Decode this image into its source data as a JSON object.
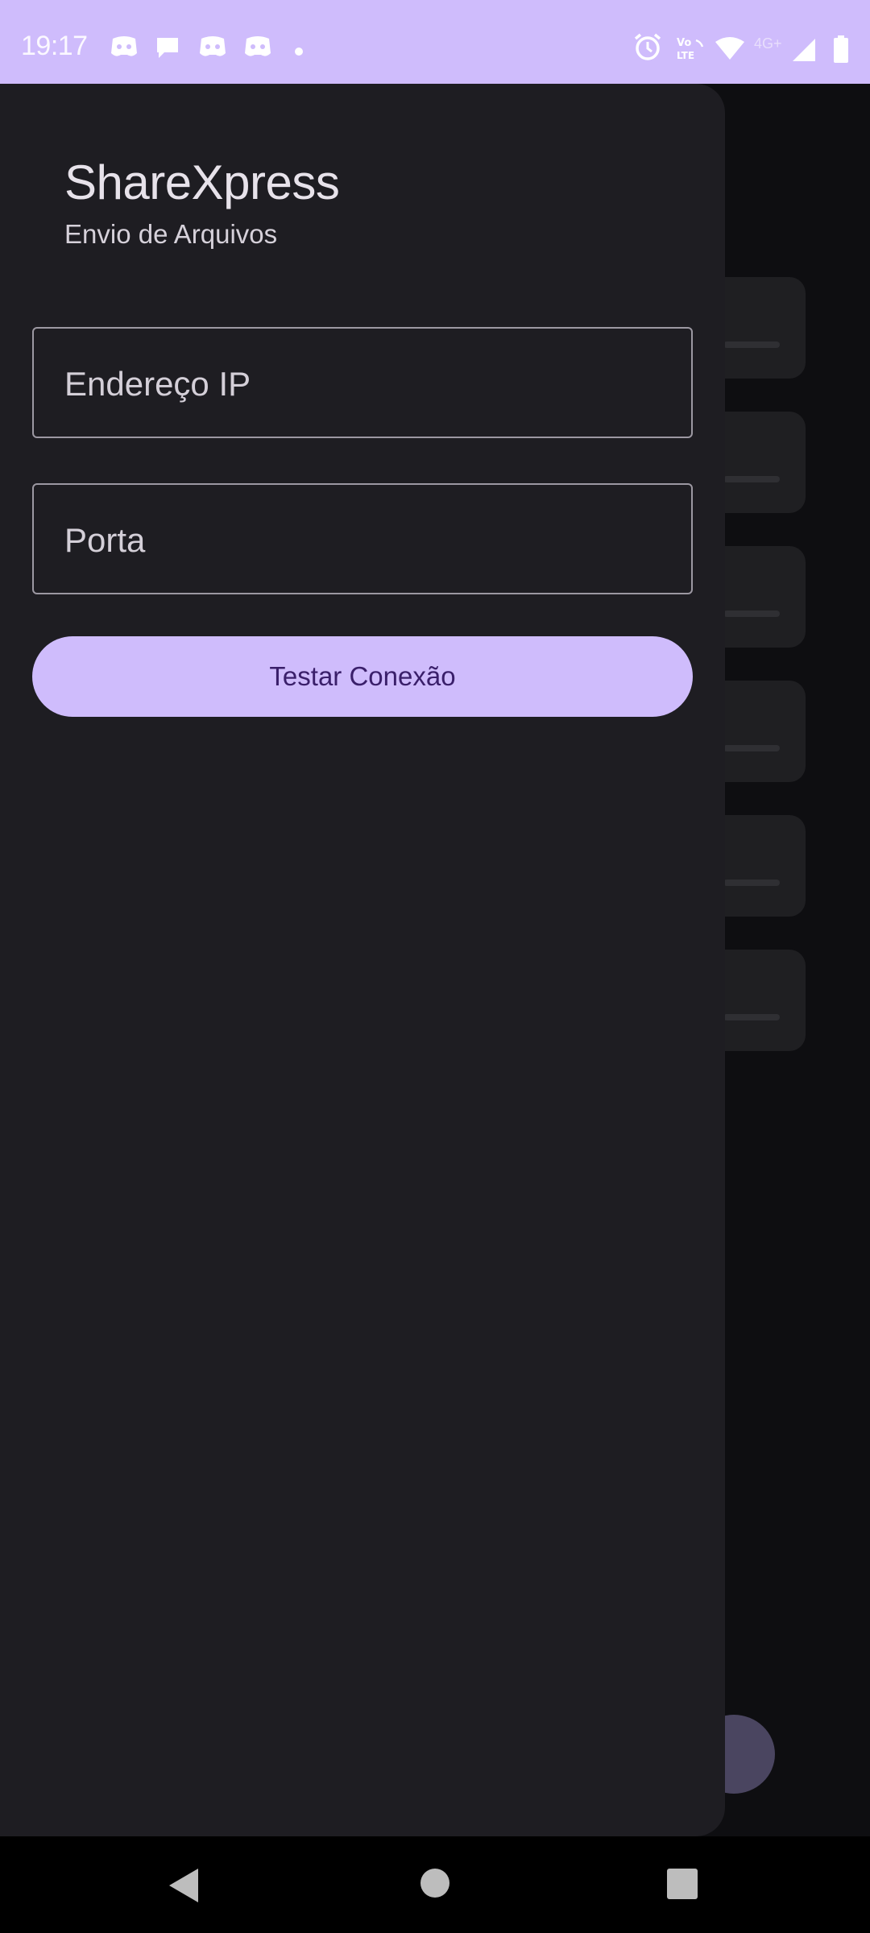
{
  "status_bar": {
    "time": "19:17",
    "background_color": "#cfbcfc",
    "notification_icons": [
      "discord-icon",
      "chat-icon",
      "discord-icon",
      "discord-icon",
      "dot-icon"
    ],
    "system_icons": [
      "alarm-icon",
      "volte-icon",
      "wifi-icon",
      "4g-icon",
      "signal-icon",
      "battery-icon"
    ],
    "network_label": "4G+"
  },
  "drawer": {
    "title": "ShareXpress",
    "subtitle": "Envio de Arquivos",
    "ip_field": {
      "placeholder": "Endereço IP",
      "value": ""
    },
    "port_field": {
      "placeholder": "Porta",
      "value": ""
    },
    "test_button_label": "Testar Conexão",
    "accent_color": "#cfbcfc"
  },
  "nav_bar": {
    "items": [
      "back-icon",
      "home-icon",
      "recents-icon"
    ]
  }
}
